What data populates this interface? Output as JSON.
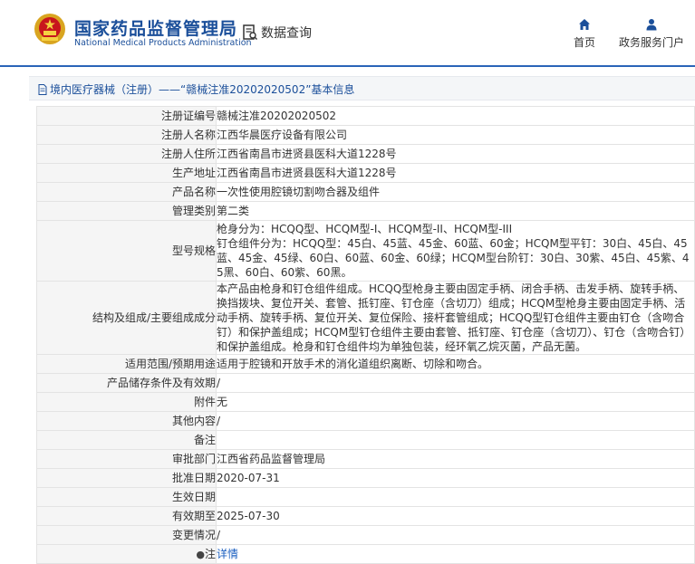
{
  "header": {
    "brand_cn": "国家药品监督管理局",
    "brand_en": "National Medical Products Administration",
    "data_query": "数据查询",
    "nav_home": "首页",
    "nav_portal": "政务服务门户",
    "accent_color": "#1b4f9a",
    "icons": [
      "national-emblem-icon",
      "data-query-icon",
      "home-icon",
      "user-icon"
    ]
  },
  "breadcrumb": {
    "text": "境内医疗器械（注册）——“赣械注准20202020502”基本信息"
  },
  "details": {
    "rows": [
      {
        "label": "注册证编号",
        "value": "赣械注准20202020502"
      },
      {
        "label": "注册人名称",
        "value": "江西华晨医疗设备有限公司"
      },
      {
        "label": "注册人住所",
        "value": "江西省南昌市进贤县医科大道1228号"
      },
      {
        "label": "生产地址",
        "value": "江西省南昌市进贤县医科大道1228号"
      },
      {
        "label": "产品名称",
        "value": "一次性使用腔镜切割吻合器及组件"
      },
      {
        "label": "管理类别",
        "value": "第二类"
      },
      {
        "label": "型号规格",
        "value": "枪身分为：HCQQ型、HCQM型-I、HCQM型-II、HCQM型-III\n钉仓组件分为：HCQQ型：45白、45蓝、45金、60蓝、60金；HCQM型平钉：30白、45白、45蓝、45金、45绿、60白、60蓝、60金、60绿；HCQM型台阶钉：30白、30紫、45白、45紫、45黑、60白、60紫、60黑。"
      },
      {
        "label": "结构及组成/主要组成成分",
        "value": "本产品由枪身和钉仓组件组成。HCQQ型枪身主要由固定手柄、闭合手柄、击发手柄、旋转手柄、换挡拨块、复位开关、套管、抵钉座、钉仓座（含切刀）组成；HCQM型枪身主要由固定手柄、活动手柄、旋转手柄、复位开关、复位保险、接杆套管组成；HCQQ型钉仓组件主要由钉仓（含吻合钉）和保护盖组成；HCQM型钉仓组件主要由套管、抵钉座、钉仓座（含切刀）、钉仓（含吻合钉）和保护盖组成。枪身和钉仓组件均为单独包装，经环氧乙烷灭菌，产品无菌。"
      },
      {
        "label": "适用范围/预期用途",
        "value": "适用于腔镜和开放手术的消化道组织离断、切除和吻合。"
      },
      {
        "label": "产品储存条件及有效期",
        "value": "/"
      },
      {
        "label": "附件",
        "value": "无"
      },
      {
        "label": "其他内容",
        "value": "/"
      },
      {
        "label": "备注",
        "value": ""
      },
      {
        "label": "审批部门",
        "value": "江西省药品监督管理局"
      },
      {
        "label": "批准日期",
        "value": "2020-07-31"
      },
      {
        "label": "生效日期",
        "value": ""
      },
      {
        "label": "有效期至",
        "value": "2025-07-30"
      },
      {
        "label": "变更情况",
        "value": "/"
      }
    ],
    "note_label": "注",
    "note_link": "详情",
    "note_icon": "pin-icon"
  }
}
